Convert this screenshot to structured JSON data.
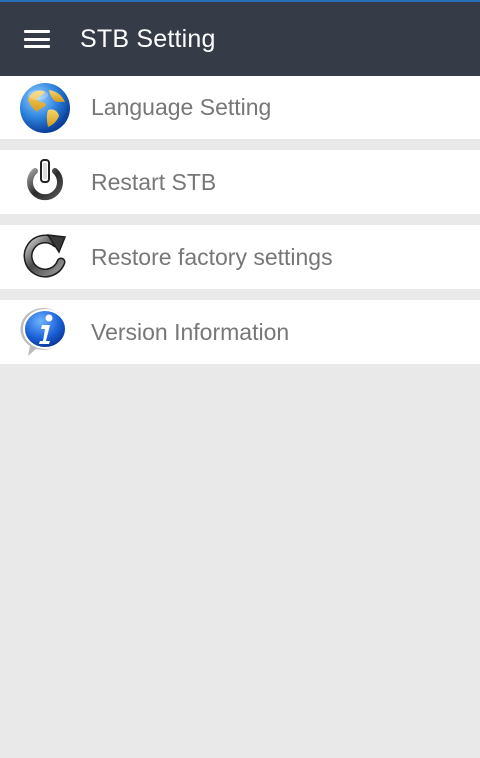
{
  "app": {
    "title": "STB Setting"
  },
  "toolbar": {
    "menu_icon": "hamburger-icon"
  },
  "settings": {
    "items": [
      {
        "label": "Language Setting",
        "icon": "globe-icon"
      },
      {
        "label": "Restart STB",
        "icon": "power-icon"
      },
      {
        "label": "Restore factory settings",
        "icon": "refresh-icon"
      },
      {
        "label": "Version Information",
        "icon": "info-icon"
      }
    ]
  },
  "colors": {
    "appbar": "#353b47",
    "accent_line": "#2a6fbf",
    "background": "#e9e9e9",
    "item_background": "#ffffff",
    "label_text": "#777777"
  }
}
